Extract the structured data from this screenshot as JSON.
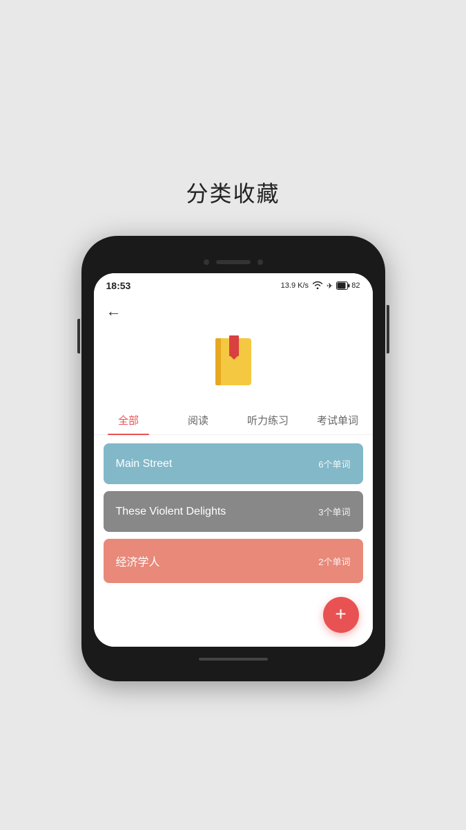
{
  "page": {
    "title": "分类收藏"
  },
  "status_bar": {
    "time": "18:53",
    "speed": "13.9 K/s",
    "wifi": "wifi",
    "airplane": "✈",
    "battery": "82"
  },
  "tabs": [
    {
      "label": "全部",
      "active": true
    },
    {
      "label": "阅读",
      "active": false
    },
    {
      "label": "听力练习",
      "active": false
    },
    {
      "label": "考试单词",
      "active": false
    }
  ],
  "list_items": [
    {
      "title": "Main Street",
      "count": "6个单词",
      "color": "blue"
    },
    {
      "title": "These Violent Delights",
      "count": "3个单词",
      "color": "gray"
    },
    {
      "title": "经济学人",
      "count": "2个单词",
      "color": "salmon"
    }
  ],
  "fab": {
    "label": "+"
  },
  "back_button": "←"
}
